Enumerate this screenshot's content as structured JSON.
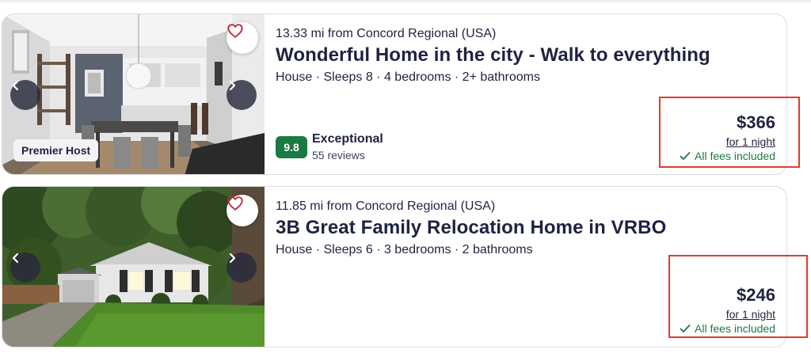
{
  "listings": [
    {
      "distance": "13.33 mi from Concord Regional (USA)",
      "title": "Wonderful Home in the city - Walk to everything",
      "details": "House · Sleeps 8 · 4 bedrooms · 2+ bathrooms",
      "host_badge": "Premier Host",
      "rating_score": "9.8",
      "rating_label": "Exceptional",
      "reviews": "55 reviews",
      "price": "$366",
      "per_night": "for 1 night",
      "fees": "All fees included"
    },
    {
      "distance": "11.85 mi from Concord Regional (USA)",
      "title": "3B Great Family Relocation Home in VRBO",
      "details": "House · Sleeps 6 · 3 bedrooms · 2 bathrooms",
      "price": "$246",
      "per_night": "for 1 night",
      "fees": "All fees included"
    }
  ],
  "icons": {
    "favorite": "heart-icon",
    "previous": "chevron-left-icon",
    "next": "chevron-right-icon",
    "fees": "checkmark-icon"
  },
  "colors": {
    "text": "#1f2340",
    "rating_badge": "#1a7a43",
    "fees_text": "#1a7a43",
    "favorite_heart": "#c0283c",
    "highlight_box": "#e53b2c"
  }
}
